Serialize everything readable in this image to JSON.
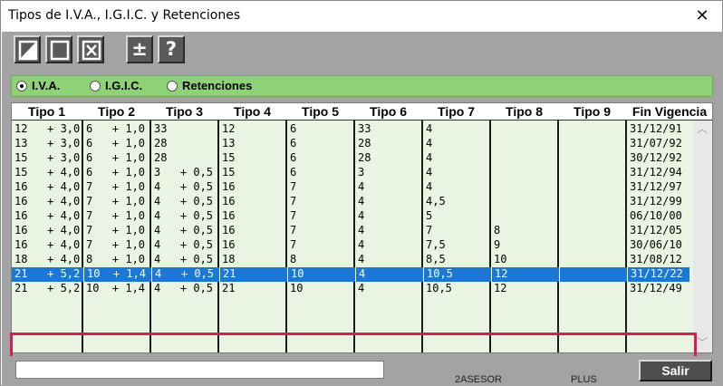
{
  "window": {
    "title": "Tipos de I.V.A., I.G.I.C. y Retenciones",
    "close_glyph": "✕"
  },
  "toolbar": {
    "buttons": [
      {
        "name": "half-fill-icon",
        "glyph": ""
      },
      {
        "name": "blank-square-icon",
        "glyph": ""
      },
      {
        "name": "x-box-icon",
        "glyph": ""
      },
      {
        "name": "plus-minus-icon",
        "glyph": "±"
      },
      {
        "name": "help-icon",
        "glyph": "?"
      }
    ]
  },
  "tax_type": {
    "options": [
      "I.V.A.",
      "I.G.I.C.",
      "Retenciones"
    ],
    "selected": "I.V.A."
  },
  "table": {
    "columns": [
      "Tipo 1",
      "Tipo 2",
      "Tipo 3",
      "Tipo 4",
      "Tipo 5",
      "Tipo 6",
      "Tipo 7",
      "Tipo 8",
      "Tipo 9",
      "Fin Vigencia"
    ],
    "rows": [
      [
        "12   + 3,0",
        "6   + 1,0",
        "33",
        "12",
        "6",
        "33",
        "4",
        "",
        "",
        "31/12/91"
      ],
      [
        "13   + 3,0",
        "6   + 1,0",
        "28",
        "13",
        "6",
        "28",
        "4",
        "",
        "",
        "31/07/92"
      ],
      [
        "15   + 3,0",
        "6   + 1,0",
        "28",
        "15",
        "6",
        "28",
        "4",
        "",
        "",
        "30/12/92"
      ],
      [
        "15   + 4,0",
        "6   + 1,0",
        "3   + 0,5",
        "15",
        "6",
        "3",
        "4",
        "",
        "",
        "31/12/94"
      ],
      [
        "16   + 4,0",
        "7   + 1,0",
        "4   + 0,5",
        "16",
        "7",
        "4",
        "4",
        "",
        "",
        "31/12/97"
      ],
      [
        "16   + 4,0",
        "7   + 1,0",
        "4   + 0,5",
        "16",
        "7",
        "4",
        "4,5",
        "",
        "",
        "31/12/99"
      ],
      [
        "16   + 4,0",
        "7   + 1,0",
        "4   + 0,5",
        "16",
        "7",
        "4",
        "5",
        "",
        "",
        "06/10/00"
      ],
      [
        "16   + 4,0",
        "7   + 1,0",
        "4   + 0,5",
        "16",
        "7",
        "4",
        "7",
        "8",
        "",
        "31/12/05"
      ],
      [
        "16   + 4,0",
        "7   + 1,0",
        "4   + 0,5",
        "16",
        "7",
        "4",
        "7,5",
        "9",
        "",
        "30/06/10"
      ],
      [
        "18   + 4,0",
        "8   + 1,0",
        "4   + 0,5",
        "18",
        "8",
        "4",
        "8,5",
        "10",
        "",
        "31/08/12"
      ],
      [
        "21   + 5,2",
        "10  + 1,4",
        "4   + 0,5",
        "21",
        "10",
        "4",
        "10,5",
        "12",
        "",
        "31/12/22"
      ],
      [
        "21   + 5,2",
        "10  + 1,4",
        "4   + 0,5",
        "21",
        "10",
        "4",
        "10,5",
        "12",
        "",
        "31/12/49"
      ]
    ],
    "selected_row": 10
  },
  "scrollbar": {
    "up": "︿",
    "down": "﹀"
  },
  "footer": {
    "status_text": "",
    "exit_label": "Salir",
    "background_text": [
      "2ASESOR",
      "PLUS"
    ]
  },
  "colors": {
    "panel": "#a3a3a3",
    "radiobar": "#8fd176",
    "grid": "#eaf4e2",
    "selection": "#1b78d4",
    "highlight_border": "#d42050"
  }
}
